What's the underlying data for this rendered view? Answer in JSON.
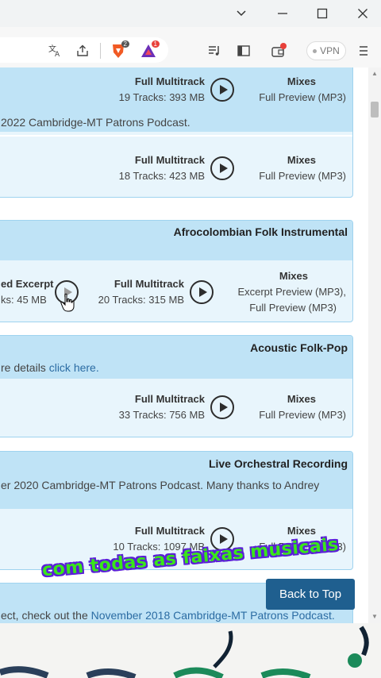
{
  "window": {
    "minimize_glyph": "—",
    "maximize_glyph": "☐",
    "close_glyph": "✕",
    "dropdown_glyph": "⌄"
  },
  "toolbar": {
    "brave_badge": "2",
    "rewards_badge": "1",
    "vpn_label": "VPN"
  },
  "cards": [
    {
      "title": "",
      "description": "2022 Cambridge-MT Patrons Podcast.",
      "rows": [
        {
          "multitrack_label": "Full Multitrack",
          "multitrack_info": "19 Tracks: 393 MB",
          "mixes_label": "Mixes",
          "mixes_info": "Full Preview (MP3)"
        },
        {
          "multitrack_label": "Full Multitrack",
          "multitrack_info": "18 Tracks: 423 MB",
          "mixes_label": "Mixes",
          "mixes_info": "Full Preview (MP3)"
        }
      ]
    },
    {
      "title": "Afrocolombian Folk Instrumental",
      "excerpt_label": "ed Excerpt",
      "excerpt_info": "ks: 45 MB",
      "rows": [
        {
          "multitrack_label": "Full Multitrack",
          "multitrack_info": "20 Tracks: 315 MB",
          "mixes_label": "Mixes",
          "mixes_info": "Excerpt Preview (MP3),",
          "mixes_info2": "Full Preview (MP3)"
        }
      ]
    },
    {
      "title": "Acoustic Folk-Pop",
      "description_prefix": "re details ",
      "description_link": "click here.",
      "rows": [
        {
          "multitrack_label": "Full Multitrack",
          "multitrack_info": "33 Tracks: 756 MB",
          "mixes_label": "Mixes",
          "mixes_info": "Full Preview (MP3)"
        }
      ]
    },
    {
      "title": "Live Orchestral Recording",
      "description": "er 2020 Cambridge-MT Patrons Podcast. Many thanks to Andrey",
      "rows": [
        {
          "multitrack_label": "Full Multitrack",
          "multitrack_info": "10 Tracks: 1097 MB",
          "mixes_label": "Mixes",
          "mixes_info": "Full Preview (MP3)"
        }
      ]
    },
    {
      "description_prefix": "ect, check out the ",
      "description_link": "November 2018 Cambridge-MT Patrons Podcast."
    }
  ],
  "back_to_top": "Back to Top",
  "caption": "com todas as faixas musicais",
  "colors": {
    "card_bg": "#e8f5fc",
    "card_head": "#bfe3f6",
    "card_border": "#9fd3ef",
    "button_blue": "#1f5f8f",
    "caption_green": "#39e61a",
    "caption_outline": "#5a1fd6"
  }
}
